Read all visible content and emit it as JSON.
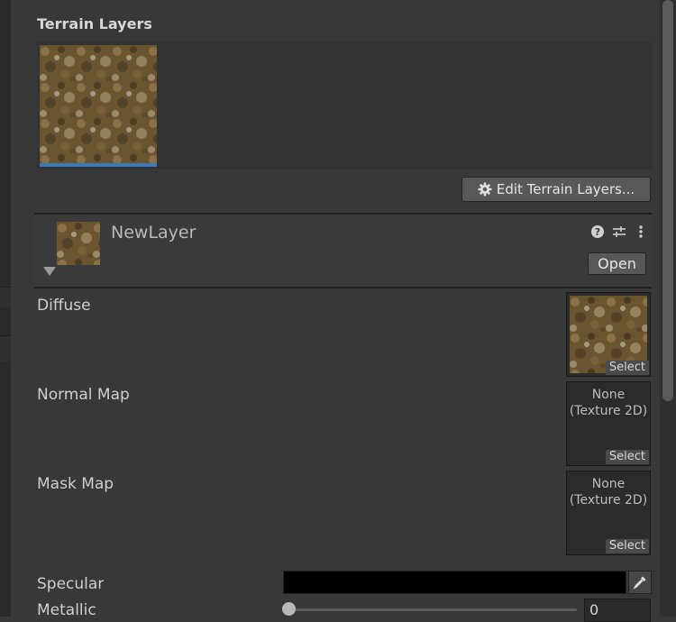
{
  "terrain_layers": {
    "title": "Terrain Layers",
    "edit_button_label": "Edit Terrain Layers..."
  },
  "layer": {
    "name": "NewLayer",
    "open_label": "Open"
  },
  "properties": {
    "diffuse": {
      "label": "Diffuse",
      "select_label": "Select"
    },
    "normal_map": {
      "label": "Normal Map",
      "value_line1": "None",
      "value_line2": "(Texture 2D)",
      "select_label": "Select"
    },
    "mask_map": {
      "label": "Mask Map",
      "value_line1": "None",
      "value_line2": "(Texture 2D)",
      "select_label": "Select"
    },
    "specular": {
      "label": "Specular",
      "color": "#000000"
    },
    "metallic": {
      "label": "Metallic",
      "value": "0"
    }
  },
  "icons": [
    "gear-icon",
    "help-icon",
    "preset-icon",
    "more-icon",
    "eyedropper-icon",
    "foldout-arrow-icon"
  ],
  "colors": {
    "background": "#383838",
    "selection_accent": "#3a79bb"
  }
}
